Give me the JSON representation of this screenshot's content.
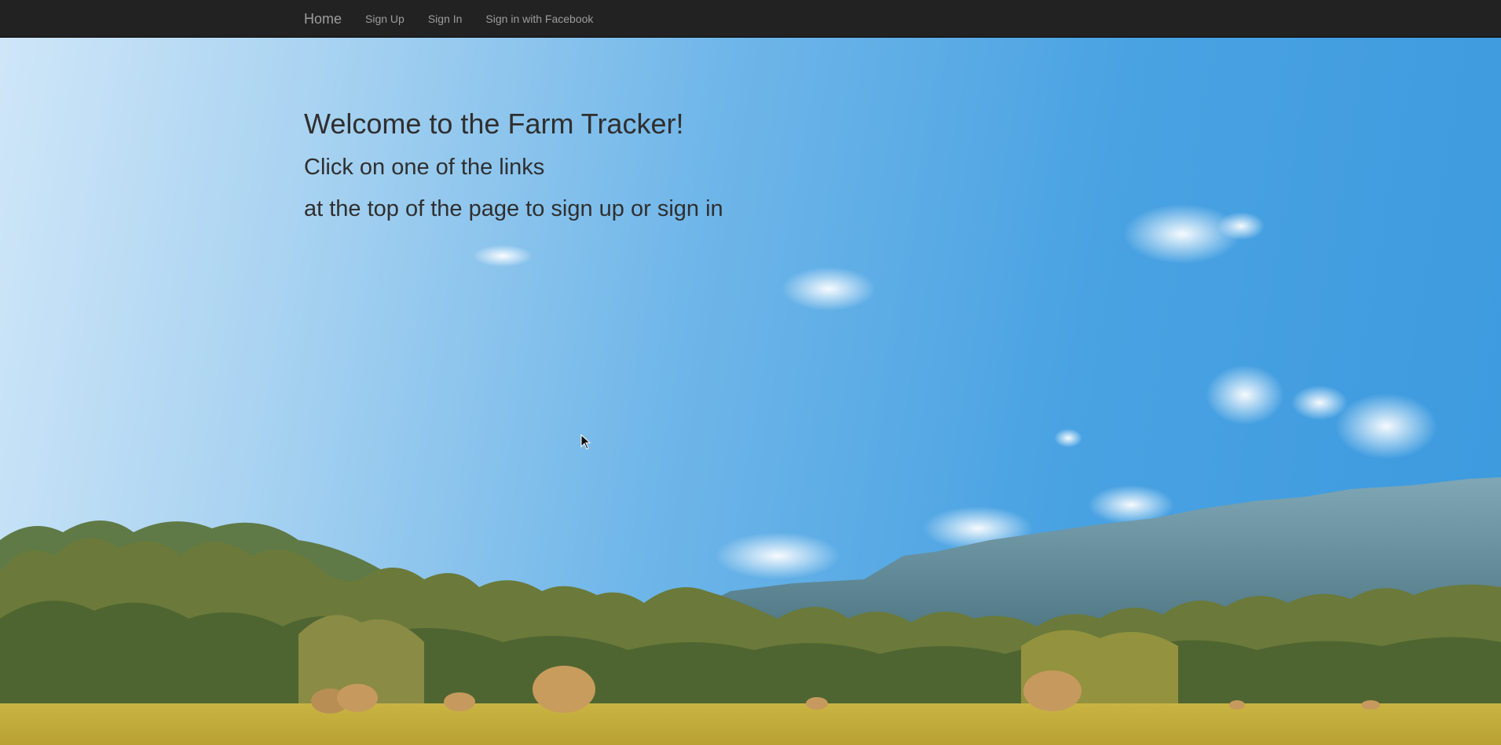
{
  "navbar": {
    "brand": "Home",
    "links": [
      "Sign Up",
      "Sign In",
      "Sign in with Facebook"
    ]
  },
  "main": {
    "heading": "Welcome to the Farm Tracker!",
    "line1": "Click on one of the links",
    "line2": "at the top of the page to sign up or sign in"
  },
  "colors": {
    "navbar_bg": "#222222",
    "nav_text": "#9d9d9d",
    "heading_text": "#2f2f2f",
    "sky": "#49a2e2",
    "field": "#c9b443"
  },
  "background": {
    "subject": "farm landscape with blue sky, clouds, cliffs, trees and hay bales"
  }
}
